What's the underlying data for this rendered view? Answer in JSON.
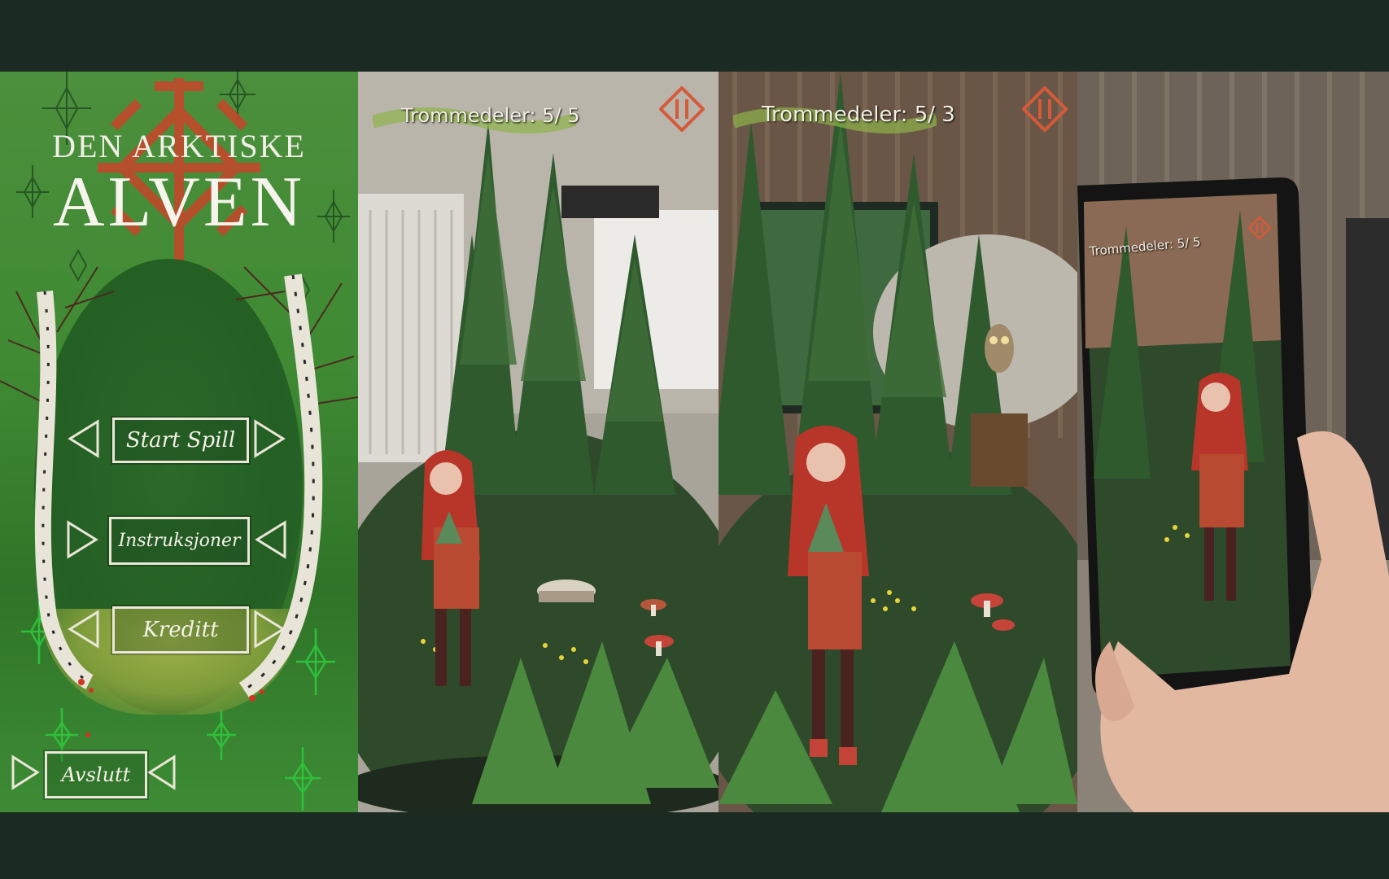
{
  "menu": {
    "title_line1": "DEN ARKTISKE",
    "title_line2": "ALVEN",
    "buttons": {
      "start": "Start Spill",
      "instructions": "Instruksjoner",
      "credits": "Kreditt",
      "quit": "Avslutt"
    }
  },
  "screens": [
    {
      "hud_label": "Trommedeler: 5/ 5",
      "pause_icon": "pause-rune-icon"
    },
    {
      "hud_label": "Trommedeler: 5/ 3",
      "pause_icon": "pause-rune-icon"
    },
    {
      "hud_label": "Trommedeler: 5/ 5",
      "pause_icon": "pause-rune-icon"
    }
  ],
  "colors": {
    "background": "#1b2b24",
    "menu_green": "#3f8a33",
    "rune_red": "#c8452a",
    "button_border": "#eae6d8"
  }
}
